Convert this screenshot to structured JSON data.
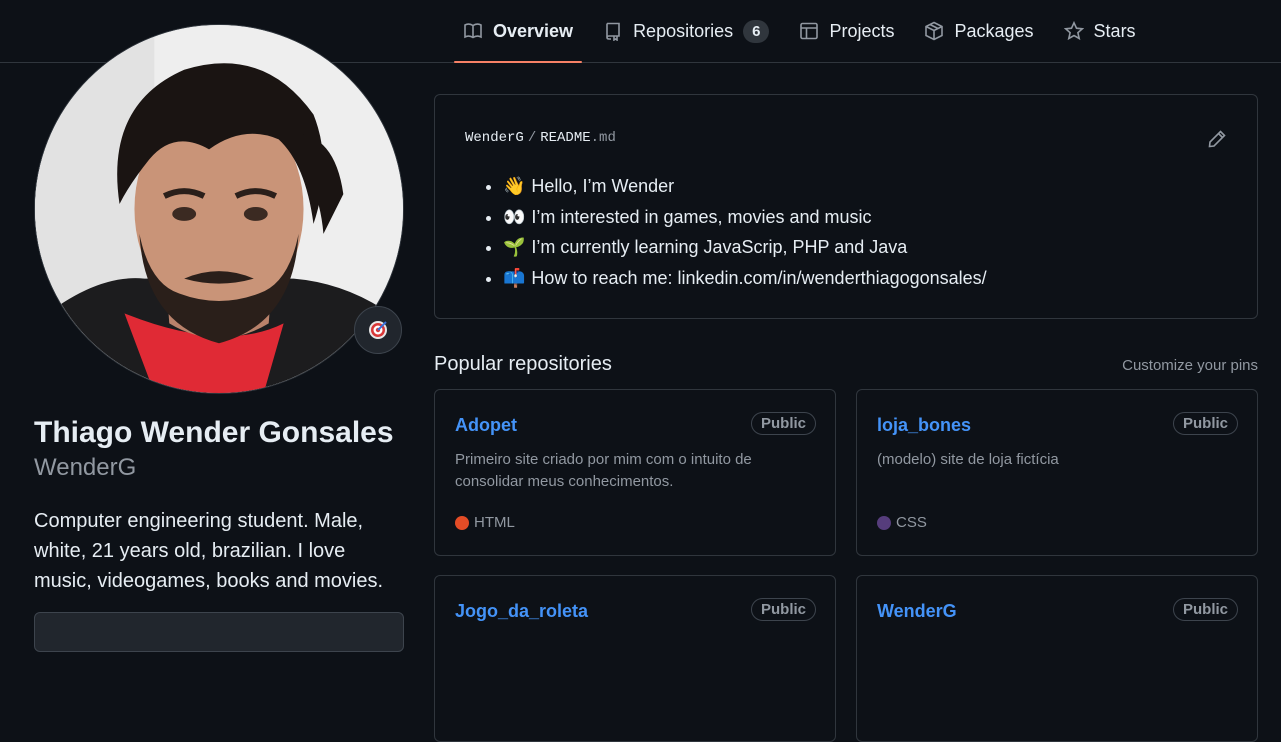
{
  "nav": {
    "tabs": [
      {
        "label": "Overview",
        "icon": "book-icon",
        "active": true
      },
      {
        "label": "Repositories",
        "icon": "repo-icon",
        "count": "6"
      },
      {
        "label": "Projects",
        "icon": "table-icon"
      },
      {
        "label": "Packages",
        "icon": "package-icon"
      },
      {
        "label": "Stars",
        "icon": "star-icon"
      }
    ]
  },
  "profile": {
    "full_name": "Thiago Wender Gonsales",
    "login": "WenderG",
    "bio": "Computer engineering student. Male, white, 21 years old, brazilian. I love music, videogames, books and movies.",
    "status_emoji": "🎯"
  },
  "readme": {
    "owner": "WenderG",
    "separator": "/",
    "file": "README",
    "ext": ".md",
    "items": [
      {
        "emoji": "👋",
        "text": "Hello, I’m Wender"
      },
      {
        "emoji": "👀",
        "text": "I’m interested in games, movies and music"
      },
      {
        "emoji": "🌱",
        "text": "I’m currently learning JavaScrip, PHP and Java"
      },
      {
        "emoji": "📫",
        "text": "How to reach me: linkedin.com/in/wenderthiagogonsales/"
      }
    ]
  },
  "popular": {
    "title": "Popular repositories",
    "customize": "Customize your pins",
    "repos": [
      {
        "name": "Adopet",
        "visibility": "Public",
        "description": "Primeiro site criado por mim com o intuito de consolidar meus conhecimentos.",
        "language": "HTML",
        "language_color": "#e34c26"
      },
      {
        "name": "loja_bones",
        "visibility": "Public",
        "description": "(modelo) site de loja fictícia",
        "language": "CSS",
        "language_color": "#563d7c"
      },
      {
        "name": "Jogo_da_roleta",
        "visibility": "Public",
        "description": "",
        "language": "",
        "language_color": ""
      },
      {
        "name": "WenderG",
        "visibility": "Public",
        "description": "",
        "language": "",
        "language_color": ""
      }
    ]
  },
  "colors": {
    "accent": "#f78166",
    "link": "#4493f8",
    "background": "#0d1117",
    "border": "#30363d"
  }
}
